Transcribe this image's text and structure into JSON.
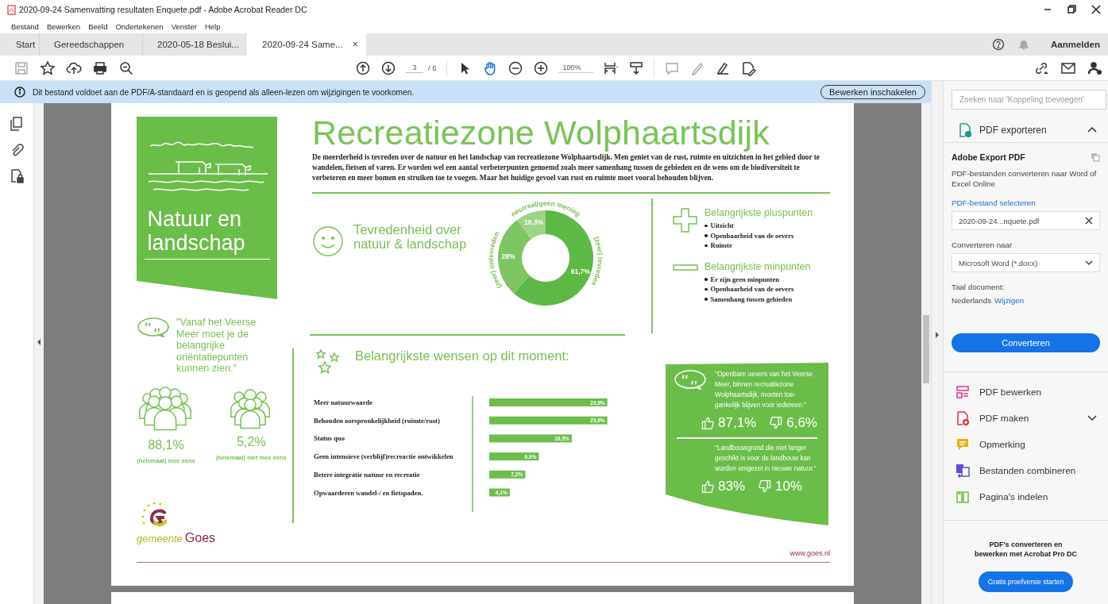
{
  "window": {
    "title": "2020-09-24 Samenvatting resultaten Enquete.pdf - Adobe Acrobat Reader DC"
  },
  "menu": [
    "Bestand",
    "Bewerken",
    "Beeld",
    "Ondertekenen",
    "Venster",
    "Help"
  ],
  "tabs": [
    {
      "label": "Start",
      "selected": false
    },
    {
      "label": "Gereedschappen",
      "selected": false
    },
    {
      "label": "2020-05-18 Beslui...",
      "selected": false
    },
    {
      "label": "2020-09-24 Same...",
      "selected": true,
      "close": "×"
    }
  ],
  "account": {
    "sign_in": "Aanmelden"
  },
  "toolbar": {
    "page": "3",
    "page_count": "/ 6",
    "zoom": "100%"
  },
  "info_bar": {
    "message": "Dit bestand voldoet aan de PDF/A-standaard en is geopend als alleen-lezen om wijzigingen te voorkomen.",
    "button": "Bewerken inschakelen"
  },
  "document": {
    "title": "Recreatiezone Wolphaartsdijk",
    "intro": "De meerderheid is tevreden over de natuur en het landschap van recreatiezone Wolphaartsdijk. Men geniet van de rust, ruimte en uitzichten in het gebied door te wandelen, fietsen of varen. Er worden wel een aantal verbeterpunten genoemd zoals meer samenhang tussen de gebieden en de wens om de biodiversiteit te verbeteren en meer bomen en struiken toe te voegen. Maar het huidige gevoel van rust en ruimte moet vooral behouden blijven.",
    "theme_panel": {
      "title": "Natuur en landschap"
    },
    "satisfaction": {
      "title": "Tevredenheid over natuur & landschap",
      "chart_data": {
        "type": "donut",
        "categories": [
          "(zeer) tevreden",
          "(zeer) ontevreden",
          "neutraal/geen mening"
        ],
        "values": [
          61.7,
          28,
          10.3
        ],
        "value_labels": [
          "61,7%",
          "28%",
          "10,3%"
        ]
      }
    },
    "pluses": {
      "title": "Belangrijkste pluspunten",
      "items": [
        "Uitzicht",
        "Openbaarheid van de oevers",
        "Ruimte"
      ]
    },
    "minuses": {
      "title": "Belangrijkste minpunten",
      "items": [
        "Er zijn geen minpunten",
        "Openbaarheid van de oevers",
        "Samenhang tussen gebieden"
      ]
    },
    "quote": "\"Vanaf het Veerse Meer moet je de belangrijke oriëntatiepunten kunnen zien.\"",
    "agreement": [
      {
        "kind": "large",
        "value": "88,1%",
        "label": "(helemaal) mee eens"
      },
      {
        "kind": "small",
        "value": "5,2%",
        "label": "(helemaal) niet mee eens"
      }
    ],
    "wishes": {
      "title": "Belangrijkste wensen op dit moment:",
      "chart_data": {
        "type": "bar",
        "orientation": "horizontal",
        "categories": [
          "Meer natuurwaarde",
          "Behouden oorspronkelijkheid (ruimte/rust)",
          "Status quo",
          "Geen intensieve (verblijf)recreactie ontwikkelen",
          "Betere integratie natuur en recreatie",
          "Opwaarderen wandel-/ en fietspaden."
        ],
        "values": [
          23.6,
          23.6,
          16.5,
          9.9,
          7.2,
          4.1
        ],
        "value_labels": [
          "23,6%",
          "23,6%",
          "16,5%",
          "9,9%",
          "7,2%",
          "4,1%"
        ]
      }
    },
    "statements": [
      {
        "kind": "bubble",
        "quote": "\"Openbare oevers van het Veerse Meer, binnen recreatiezone Wolphaartsdijk, moeten toe-gankelijk blijven voor iedereen.\"",
        "agree": "87,1%",
        "disagree": "6,6%"
      },
      {
        "kind": "plain",
        "quote": "\"Landbouwgrond die niet langer geschikt is voor de landbouw kan worden omgezet in nieuwe natuur.\"",
        "agree": "83%",
        "disagree": "10%"
      }
    ],
    "logo": {
      "prefix": "gemeente",
      "name": "Goes"
    },
    "url": "www.goes.nl"
  },
  "side_panel": {
    "search_placeholder": "Zoeken naar 'Koppeling toevoegen'",
    "export": {
      "title": "PDF exporteren",
      "expanded": true,
      "heading": "Adobe Export PDF",
      "description": "PDF-bestanden converteren naar Word of Excel Online",
      "select_link": "PDF-bestand selecteren",
      "file": "2020-09-24...nquete.pdf",
      "convert_label": "Converteren naar",
      "format": "Microsoft Word (*.docx)",
      "language_label": "Taal document:",
      "language": "Nederlands",
      "change_link": "Wijzigen",
      "button": "Converteren"
    },
    "tools": [
      {
        "kind": "edit",
        "label": "PDF bewerken",
        "expandable": false
      },
      {
        "kind": "create",
        "label": "PDF maken",
        "expandable": true
      },
      {
        "kind": "comment",
        "label": "Opmerking",
        "expandable": false
      },
      {
        "kind": "combine",
        "label": "Bestanden combineren",
        "expandable": false
      },
      {
        "kind": "organize",
        "label": "Pagina's indelen",
        "expandable": false
      }
    ],
    "promo": {
      "text": "PDF's converteren en bewerken met Acrobat Pro DC",
      "button": "Gratis proefversie starten"
    }
  }
}
